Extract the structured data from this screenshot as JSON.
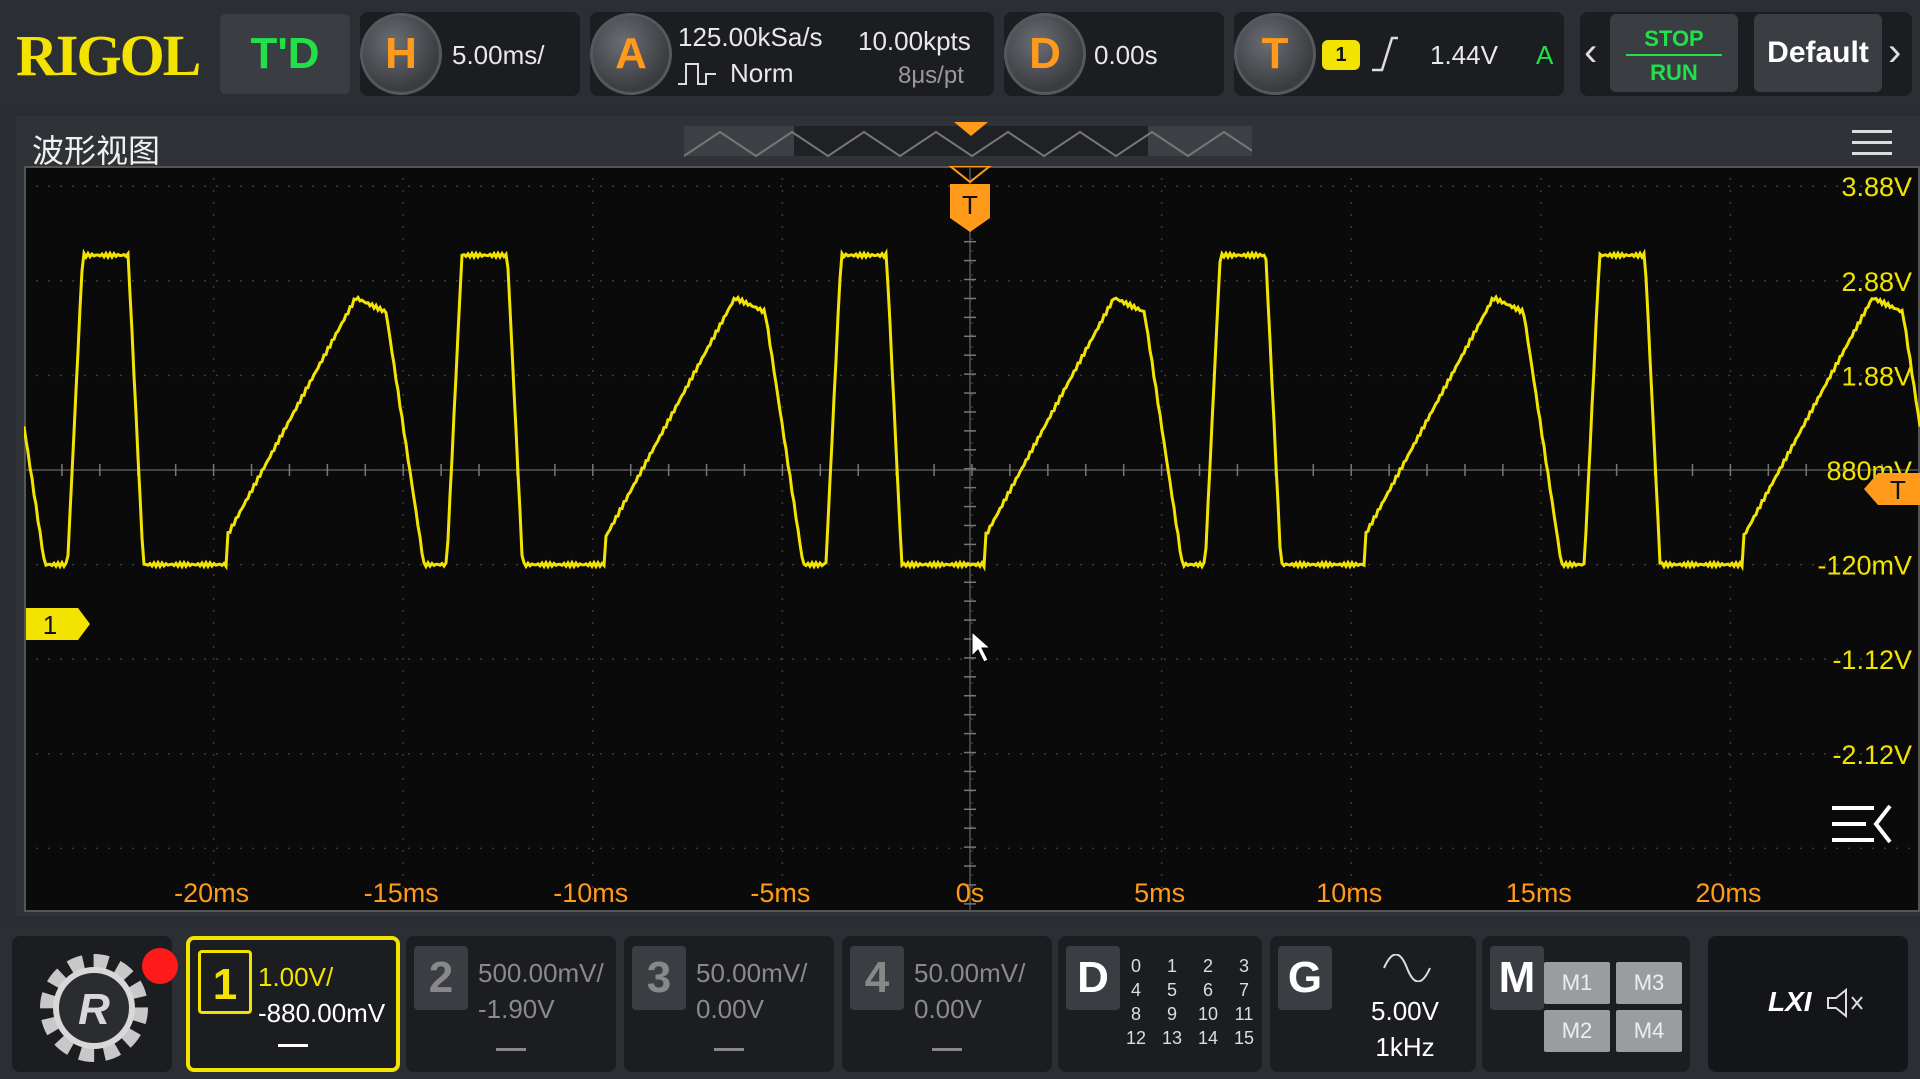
{
  "topbar": {
    "brand": "RIGOL",
    "td_label": "T'D",
    "horizontal": {
      "badge": "H",
      "timebase": "5.00ms/"
    },
    "acquire": {
      "badge": "A",
      "sample_rate": "125.00kSa/s",
      "memory_depth": "10.00kpts",
      "mode": "Norm",
      "sample_period": "8μs/pt"
    },
    "delay": {
      "badge": "D",
      "value": "0.00s"
    },
    "trigger": {
      "badge": "T",
      "source": "1",
      "level": "1.44V",
      "sweep": "A"
    },
    "stop_label": "STOP",
    "run_label": "RUN",
    "default_label": "Default"
  },
  "waveform": {
    "title": "波形视图",
    "trigger_marker": "T",
    "ch1_marker": "1",
    "trigger_level_marker": "T",
    "volt_labels": [
      "3.88V",
      "2.88V",
      "1.88V",
      "880mV",
      "-120mV",
      "-1.12V",
      "-2.12V"
    ],
    "time_labels": [
      "-20ms",
      "-15ms",
      "-10ms",
      "-5ms",
      "0s",
      "5ms",
      "10ms",
      "15ms",
      "20ms"
    ]
  },
  "channels": [
    {
      "num": "1",
      "scale": "1.00V/",
      "offset": "-880.00mV"
    },
    {
      "num": "2",
      "scale": "500.00mV/",
      "offset": "-1.90V"
    },
    {
      "num": "3",
      "scale": "50.00mV/",
      "offset": "0.00V"
    },
    {
      "num": "4",
      "scale": "50.00mV/",
      "offset": "0.00V"
    }
  ],
  "digital": {
    "badge": "D",
    "channels": [
      "0",
      "1",
      "2",
      "3",
      "4",
      "5",
      "6",
      "7",
      "8",
      "9",
      "10",
      "11",
      "12",
      "13",
      "14",
      "15"
    ]
  },
  "generator": {
    "badge": "G",
    "amplitude": "5.00V",
    "frequency": "1kHz"
  },
  "math": {
    "badge": "M",
    "buttons": [
      "M1",
      "M3",
      "M2",
      "M4"
    ]
  },
  "status": {
    "lxi_label": "LXI"
  },
  "colors": {
    "ch1": "#f2e400",
    "trigger": "#ff9a1a",
    "green": "#22e04a"
  }
}
